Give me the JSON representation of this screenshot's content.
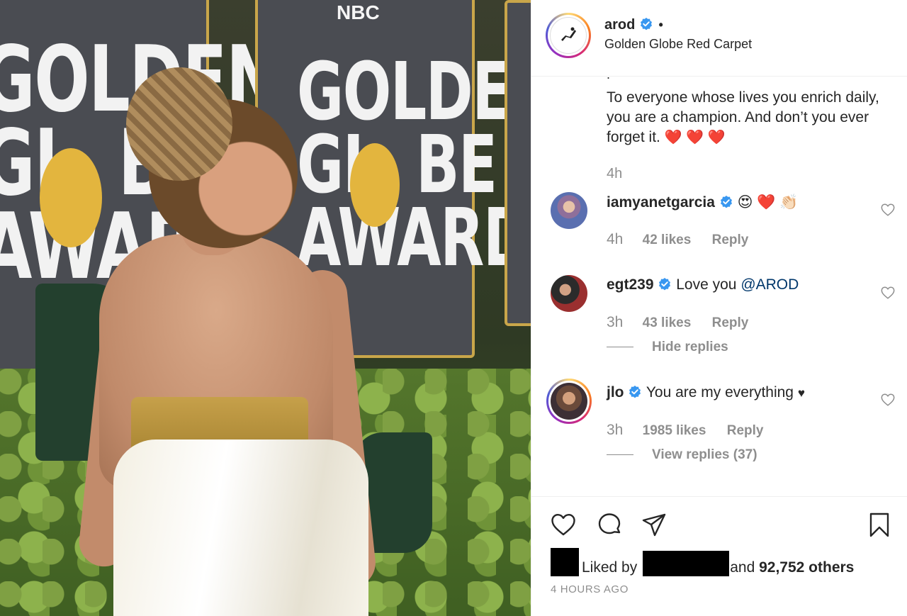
{
  "photo": {
    "network_logo": "NBC",
    "board_text": "GOLDEN\nGL  BE\nAWARDS"
  },
  "post": {
    "author": "arod",
    "author_verified": true,
    "header_separator": "•",
    "location": "Golden Globe Red Carpet",
    "caption_dot": ".",
    "caption_text": "To everyone whose lives you enrich daily, you are a champion. And don’t you ever forget it.",
    "caption_emoji": "❤️ ❤️ ❤️",
    "caption_time": "4h",
    "liked_by_prefix": "Liked by",
    "liked_by_suffix": "and",
    "others_count": "92,752 others",
    "age": "4 HOURS AGO"
  },
  "comments": [
    {
      "username": "iamyanetgarcia",
      "verified": true,
      "text": "",
      "emoji": "😍 ❤️ 👏🏻",
      "time": "4h",
      "likes": "42 likes",
      "reply_label": "Reply"
    },
    {
      "username": "egt239",
      "verified": true,
      "text": "Love you",
      "mention": "@AROD",
      "time": "3h",
      "likes": "43 likes",
      "reply_label": "Reply",
      "replies_toggle": "Hide replies"
    },
    {
      "username": "jlo",
      "verified": true,
      "text": "You are my everything",
      "emoji": "♥",
      "time": "3h",
      "likes": "1985 likes",
      "reply_label": "Reply",
      "replies_toggle": "View replies (37)"
    }
  ],
  "colors": {
    "text": "#262626",
    "secondary": "#8e8e8e",
    "verified_blue": "#3897f0",
    "mention": "#00376b",
    "board_trim": "#c9a64a"
  },
  "icons": {
    "like": "heart-outline-icon",
    "comment": "speech-bubble-icon",
    "share": "paper-plane-icon",
    "save": "bookmark-icon"
  }
}
